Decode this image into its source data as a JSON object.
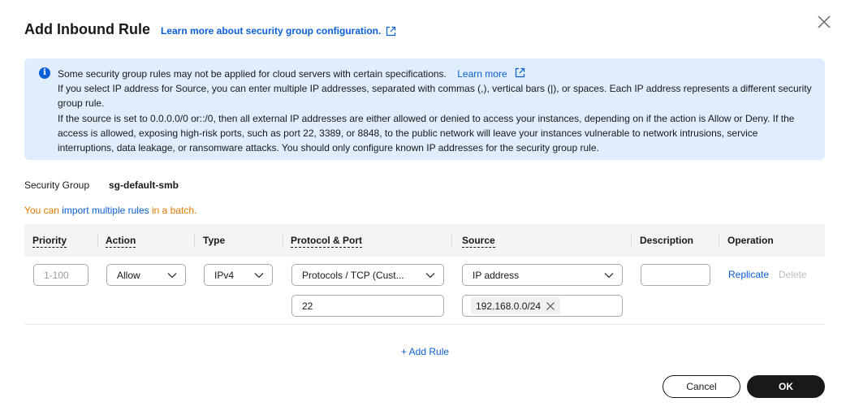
{
  "dialog": {
    "title": "Add Inbound Rule",
    "header_link": "Learn more about security group configuration.",
    "close_icon": "close-icon"
  },
  "alert": {
    "line1": "Some security group rules may not be applied for cloud servers with certain specifications.",
    "learn_more": "Learn more",
    "line2": "If you select IP address for Source, you can enter multiple IP addresses, separated with commas (,), vertical bars (|), or spaces. Each IP address represents a different security group rule.",
    "line3": "If the source is set to 0.0.0.0/0 or::/0, then all external IP addresses are either allowed or denied to access your instances, depending on if the action is Allow or Deny. If the access is allowed, exposing high-risk ports, such as port 22, 3389, or 8848, to the public network will leave your instances vulnerable to network intrusions, service interruptions, data leakage, or ransomware attacks. You should only configure known IP addresses for the security group rule."
  },
  "security_group": {
    "label": "Security Group",
    "value": "sg-default-smb"
  },
  "batch": {
    "prefix": "You can ",
    "link": "import multiple rules",
    "suffix": " in a batch."
  },
  "table": {
    "columns": [
      "Priority",
      "Action",
      "Type",
      "Protocol & Port",
      "Source",
      "Description",
      "Operation"
    ],
    "row": {
      "priority_placeholder": "1-100",
      "action": "Allow",
      "type": "IPv4",
      "protocol": "Protocols / TCP (Cust...",
      "port": "22",
      "source_type": "IP address",
      "source_tag": "192.168.0.0/24",
      "description": "",
      "replicate": "Replicate",
      "delete": "Delete"
    }
  },
  "add_rule": "+ Add Rule",
  "footer": {
    "cancel": "Cancel",
    "ok": "OK"
  },
  "colors": {
    "link": "#0b5fd6",
    "warning": "#e37a00",
    "alert_bg": "#dfedfd",
    "primary_btn": "#191919"
  }
}
